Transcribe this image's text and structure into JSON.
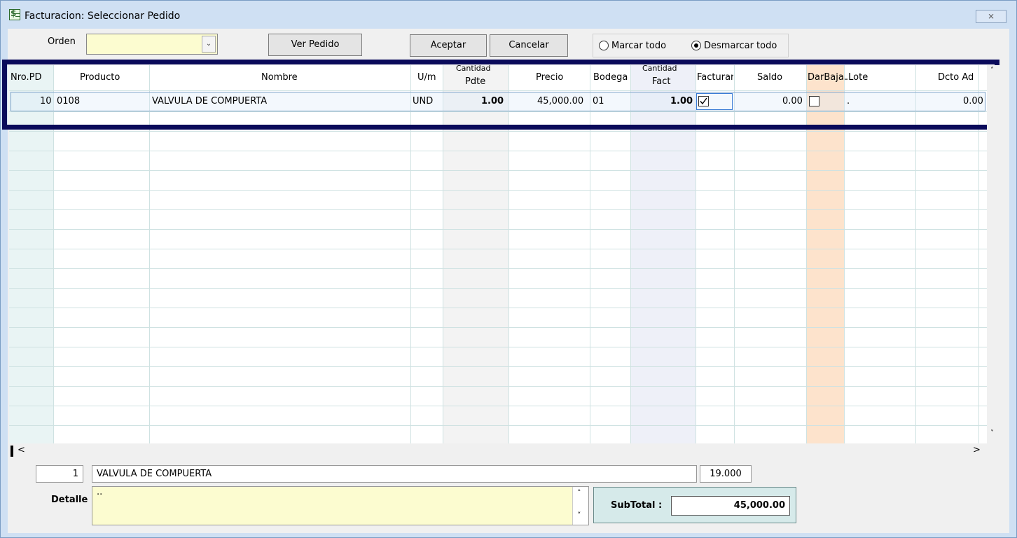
{
  "window": {
    "title": "Facturacion: Seleccionar Pedido",
    "close_glyph": "⨯"
  },
  "toolbar": {
    "orden_label": "Orden",
    "orden_value": "",
    "ver_pedido": "Ver Pedido",
    "aceptar": "Aceptar",
    "cancelar": "Cancelar",
    "marcar_todo": "Marcar todo",
    "desmarcar_todo": "Desmarcar todo",
    "selected_radio": "Desmarcar todo"
  },
  "grid": {
    "columns": [
      "Nro.PD",
      "Producto",
      "Nombre",
      "U/m",
      "Cantidad Pdte",
      "Precio",
      "Bodega",
      "Cantidad Fact",
      "Facturar",
      "Saldo",
      "DarBaja",
      ".Lote",
      "Dcto Ad"
    ],
    "header_texts": {
      "nro_pd": "Nro.PD",
      "producto": "Producto",
      "nombre": "Nombre",
      "um": "U/m",
      "cantidad_pdte_1": "Cantidad",
      "cantidad_pdte_2": "Pdte",
      "precio": "Precio",
      "bodega": "Bodega",
      "cantidad_fact_1": "Cantidad",
      "cantidad_fact_2": "Fact",
      "facturar": "Facturar",
      "saldo": "Saldo",
      "darbaja": "DarBaja.",
      "lote": ".Lote",
      "dcto_ad": "Dcto Ad"
    },
    "rows": [
      {
        "nro_pd": "10",
        "producto": "0108",
        "nombre": "VALVULA DE COMPUERTA",
        "um": "UND",
        "cantidad_pdte": "1.00",
        "precio": "45,000.00",
        "bodega": "01",
        "cantidad_fact": "1.00",
        "facturar": true,
        "saldo": "0.00",
        "darbaja": false,
        "lote": ".",
        "dcto_ad": "0.00"
      }
    ]
  },
  "footer": {
    "item_index": "1",
    "item_name": "VALVULA DE COMPUERTA",
    "tax_value": "19.000",
    "detalle_label": "Detalle",
    "detalle_text": "..",
    "subtotal_label": "SubTotal :",
    "subtotal_value": "45,000.00"
  },
  "colors": {
    "window_frame": "#cfe0f3",
    "form_bg": "#f0f0f0",
    "highlight_frame": "#0a0a5a",
    "input_yellow": "#fcfcd0",
    "darbaja_col": "#fde3cc",
    "subtotal_bg": "#d6eaea"
  }
}
